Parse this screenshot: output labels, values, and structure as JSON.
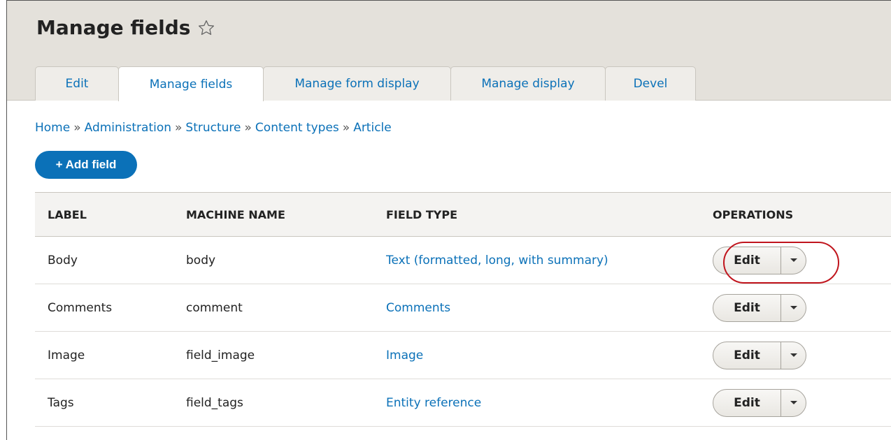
{
  "page": {
    "title": "Manage fields"
  },
  "tabs": [
    {
      "label": "Edit",
      "active": false
    },
    {
      "label": "Manage fields",
      "active": true
    },
    {
      "label": "Manage form display",
      "active": false
    },
    {
      "label": "Manage display",
      "active": false
    },
    {
      "label": "Devel",
      "active": false
    }
  ],
  "breadcrumb": [
    {
      "label": "Home"
    },
    {
      "label": "Administration"
    },
    {
      "label": "Structure"
    },
    {
      "label": "Content types"
    },
    {
      "label": "Article"
    }
  ],
  "breadcrumb_separator": "»",
  "add_field": {
    "label": "+ Add field"
  },
  "table": {
    "headers": [
      "LABEL",
      "MACHINE NAME",
      "FIELD TYPE",
      "OPERATIONS"
    ],
    "rows": [
      {
        "label": "Body",
        "machine": "body",
        "type": "Text (formatted, long, with summary)",
        "op": "Edit"
      },
      {
        "label": "Comments",
        "machine": "comment",
        "type": "Comments",
        "op": "Edit"
      },
      {
        "label": "Image",
        "machine": "field_image",
        "type": "Image",
        "op": "Edit"
      },
      {
        "label": "Tags",
        "machine": "field_tags",
        "type": "Entity reference",
        "op": "Edit"
      }
    ]
  },
  "colors": {
    "link": "#0b71b8",
    "header_bg": "#e4e1db",
    "highlight": "#c0151d"
  }
}
